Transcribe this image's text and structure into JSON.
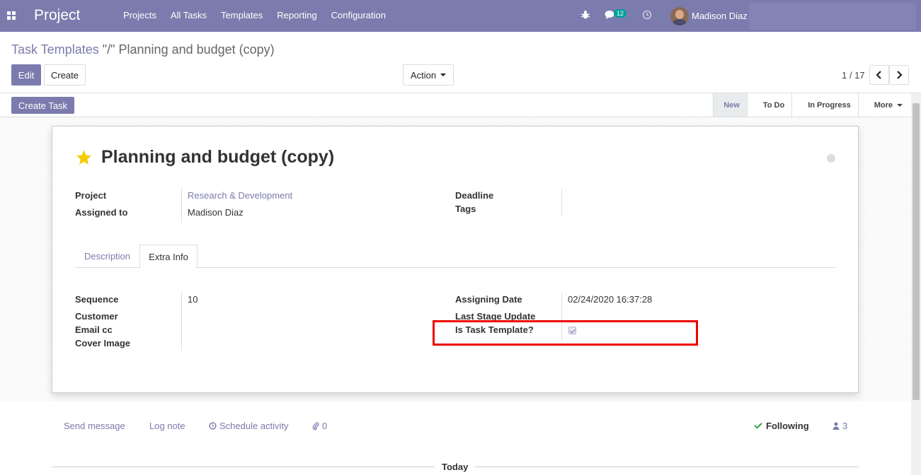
{
  "navbar": {
    "brand": "Project",
    "menu": [
      "Projects",
      "All Tasks",
      "Templates",
      "Reporting",
      "Configuration"
    ],
    "messages_count": "12",
    "user_name": "Madison Diaz"
  },
  "control_panel": {
    "breadcrumb_parent": "Task Templates",
    "breadcrumb_separator": "\"/\"",
    "breadcrumb_current": "Planning and budget (copy)",
    "edit_label": "Edit",
    "create_label": "Create",
    "action_label": "Action",
    "pager_value": "1 / 17"
  },
  "statusbar": {
    "create_task_label": "Create Task",
    "stages": [
      "New",
      "To Do",
      "In Progress",
      "More"
    ],
    "active_stage": "New"
  },
  "form": {
    "title": "Planning and budget (copy)",
    "fields_left": [
      {
        "label": "Project",
        "value": "Research & Development"
      },
      {
        "label": "Assigned to",
        "value": "Madison Diaz"
      }
    ],
    "fields_right": [
      {
        "label": "Deadline",
        "value": ""
      },
      {
        "label": "Tags",
        "value": ""
      }
    ],
    "tabs": [
      "Description",
      "Extra Info"
    ],
    "active_tab": "Extra Info",
    "extra_left": [
      {
        "label": "Sequence",
        "value": "10"
      },
      {
        "label": "Customer",
        "value": ""
      },
      {
        "label": "Email cc",
        "value": ""
      },
      {
        "label": "Cover Image",
        "value": ""
      }
    ],
    "extra_right": [
      {
        "label": "Assigning Date",
        "value": "02/24/2020 16:37:28"
      },
      {
        "label": "Last Stage Update",
        "value": ""
      },
      {
        "label": "Is Task Template?",
        "value": true
      }
    ]
  },
  "chatter": {
    "send_message": "Send message",
    "log_note": "Log note",
    "schedule_activity": "Schedule activity",
    "attachments_count": "0",
    "following_label": "Following",
    "followers_count": "3",
    "today_label": "Today"
  },
  "colors": {
    "brand": "#7c7bad",
    "highlight": "#e00000",
    "following_check": "#28a745"
  }
}
